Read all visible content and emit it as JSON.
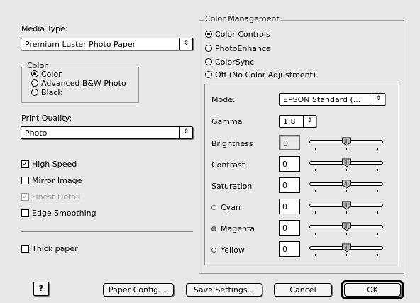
{
  "media_type": {
    "label": "Media Type:",
    "value": "Premium Luster Photo Paper"
  },
  "color": {
    "title": "Color",
    "options": [
      "Color",
      "Advanced B&W Photo",
      "Black"
    ],
    "selected": "Color"
  },
  "print_quality": {
    "label": "Print Quality:",
    "value": "Photo"
  },
  "options": {
    "high_speed": {
      "label": "High Speed",
      "checked": true
    },
    "mirror_image": {
      "label": "Mirror Image",
      "checked": false
    },
    "finest_detail": {
      "label": "Finest Detail",
      "checked": true,
      "disabled": true
    },
    "edge_smoothing": {
      "label": "Edge Smoothing",
      "checked": false
    },
    "thick_paper": {
      "label": "Thick paper",
      "checked": false
    }
  },
  "color_management": {
    "title": "Color Management",
    "options": [
      "Color Controls",
      "PhotoEnhance",
      "ColorSync",
      "Off (No Color Adjustment)"
    ],
    "selected": "Color Controls",
    "mode": {
      "label": "Mode:",
      "value": "EPSON Standard (..."
    },
    "gamma": {
      "label": "Gamma",
      "value": "1.8"
    },
    "adjustments": [
      {
        "label": "Brightness",
        "value": "0",
        "level": 0
      },
      {
        "label": "Contrast",
        "value": "0",
        "level": 0
      },
      {
        "label": "Saturation",
        "value": "0",
        "level": 0
      },
      {
        "label": "Cyan",
        "value": "0",
        "level": 0,
        "dot_color": "#ffffff"
      },
      {
        "label": "Magenta",
        "value": "0",
        "level": 0,
        "dot_color": "#8a8a8a"
      },
      {
        "label": "Yellow",
        "value": "0",
        "level": 0,
        "dot_color": "#ffffff"
      }
    ]
  },
  "buttons": {
    "help": "?",
    "paper_config": "Paper Config....",
    "save_settings": "Save Settings...",
    "cancel": "Cancel",
    "ok": "OK"
  },
  "icons": {
    "popup_arrow": "popup-arrows-icon",
    "check": "checkmark-icon",
    "help": "help-icon"
  }
}
